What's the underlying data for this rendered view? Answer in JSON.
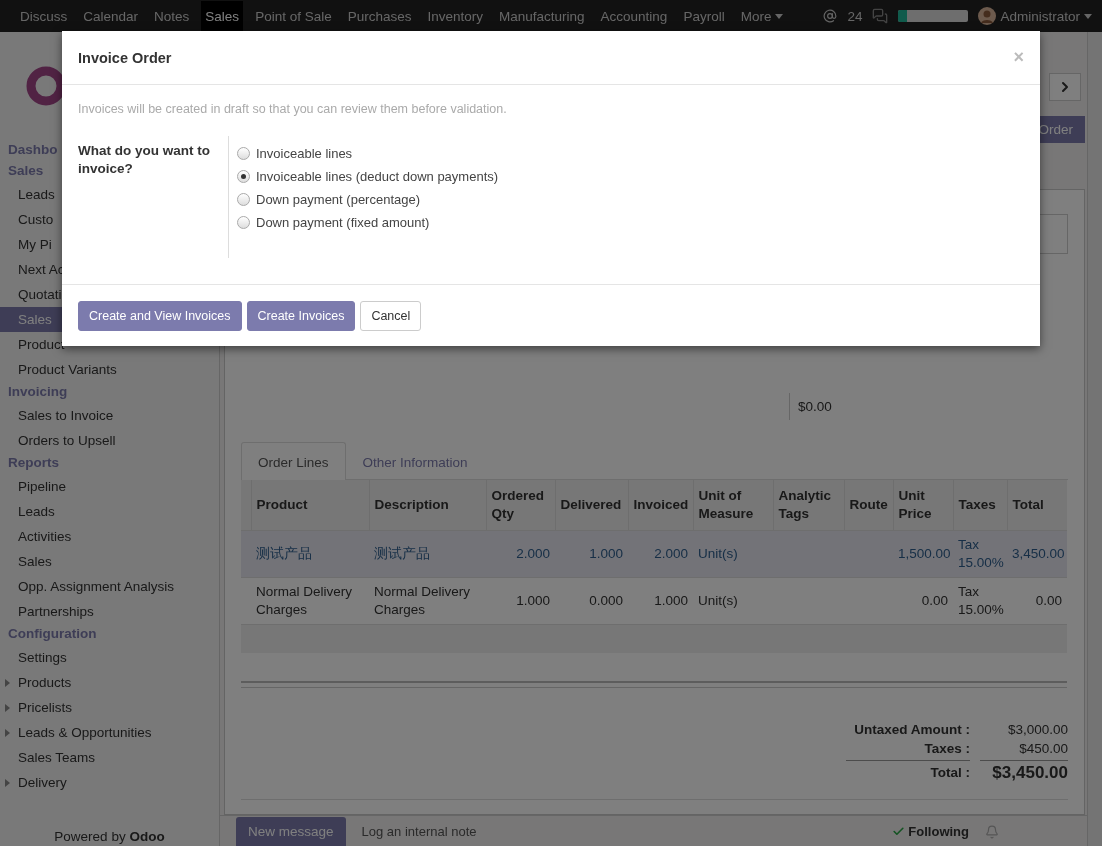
{
  "nav": {
    "items": [
      {
        "label": "Discuss",
        "selected": false
      },
      {
        "label": "Calendar",
        "selected": false
      },
      {
        "label": "Notes",
        "selected": false
      },
      {
        "label": "Sales",
        "selected": true
      },
      {
        "label": "Point of Sale",
        "selected": false
      },
      {
        "label": "Purchases",
        "selected": false
      },
      {
        "label": "Inventory",
        "selected": false
      },
      {
        "label": "Manufacturing",
        "selected": false
      },
      {
        "label": "Accounting",
        "selected": false
      },
      {
        "label": "Payroll",
        "selected": false
      },
      {
        "label": "More",
        "selected": false
      }
    ],
    "mentions": "24",
    "progress": {
      "level": 0.12
    },
    "user": "Administrator"
  },
  "sidebar": {
    "sections": [
      {
        "title": "Dashbo"
      },
      {
        "title": "Sales",
        "items": [
          {
            "label": "Leads",
            "selected": false
          },
          {
            "label": "Custo",
            "selected": false
          },
          {
            "label": "My Pi",
            "selected": false
          },
          {
            "label": "Next Ac",
            "selected": false
          },
          {
            "label": "Quotati",
            "selected": false
          },
          {
            "label": "Sales",
            "selected": true
          },
          {
            "label": "Product",
            "selected": false
          },
          {
            "label": "Product Variants",
            "selected": false
          }
        ]
      },
      {
        "title": "Invoicing",
        "items": [
          {
            "label": "Sales to Invoice",
            "selected": false
          },
          {
            "label": "Orders to Upsell",
            "selected": false
          }
        ]
      },
      {
        "title": "Reports",
        "items": [
          {
            "label": "Pipeline",
            "selected": false
          },
          {
            "label": "Leads",
            "selected": false
          },
          {
            "label": "Activities",
            "selected": false
          },
          {
            "label": "Sales",
            "selected": false
          },
          {
            "label": "Opp. Assignment Analysis",
            "selected": false
          },
          {
            "label": "Partnerships",
            "selected": false
          }
        ]
      },
      {
        "title": "Configuration",
        "items": [
          {
            "label": "Settings",
            "selected": false
          },
          {
            "label": "Products",
            "selected": false,
            "expanded": false
          },
          {
            "label": "Pricelists",
            "selected": false,
            "expanded": false
          },
          {
            "label": "Leads & Opportunities",
            "selected": false,
            "expanded": false
          },
          {
            "label": "Sales Teams",
            "selected": false
          },
          {
            "label": "Delivery",
            "selected": false,
            "expanded": false
          }
        ]
      }
    ],
    "footer": "Powered by **Odoo**"
  },
  "control_panel": {
    "action_button": "Order"
  },
  "form": {
    "amount": "$0.00",
    "tabs": [
      {
        "label": "Order Lines",
        "selected": true
      },
      {
        "label": "Other Information",
        "selected": false
      }
    ],
    "table": {
      "columns": [
        {
          "label": "Product"
        },
        {
          "label": "Description"
        },
        {
          "label": "Ordered Qty"
        },
        {
          "label": "Delivered"
        },
        {
          "label": "Invoiced"
        },
        {
          "label": "Unit of Measure"
        },
        {
          "label": "Analytic Tags"
        },
        {
          "label": "Route"
        },
        {
          "label": "Unit Price"
        },
        {
          "label": "Taxes"
        },
        {
          "label": "Total"
        }
      ],
      "rows": [
        {
          "selected": true,
          "cells": [
            "测试产品",
            "测试产品",
            "2.000",
            "1.000",
            "2.000",
            "Unit(s)",
            "",
            "",
            "1,500.00",
            "Tax 15.00%",
            "3,450.00"
          ]
        },
        {
          "selected": false,
          "cells": [
            "Normal Delivery Charges",
            "Normal Delivery Charges",
            "1.000",
            "0.000",
            "1.000",
            "Unit(s)",
            "",
            "",
            "0.00",
            "Tax 15.00%",
            "0.00"
          ]
        }
      ]
    },
    "totals": [
      {
        "label": "Untaxed Amount :",
        "value": "$3,000.00",
        "kind": "normal"
      },
      {
        "label": "Taxes :",
        "value": "$450.00",
        "kind": "normal"
      },
      {
        "label": "Total :",
        "value": "$3,450.00",
        "kind": "grand"
      }
    ]
  },
  "chatter": {
    "new_message": "New message",
    "log_note": "Log an internal note",
    "following": "Following"
  },
  "modal": {
    "title": "Invoice Order",
    "close": "×",
    "notice": "Invoices will be created in draft so that you can review them before validation.",
    "question": "What do you want to invoice?",
    "options": [
      {
        "label": "Invoiceable lines",
        "selected": false
      },
      {
        "label": "Invoiceable lines (deduct down payments)",
        "selected": true
      },
      {
        "label": "Down payment (percentage)",
        "selected": false
      },
      {
        "label": "Down payment (fixed amount)",
        "selected": false
      }
    ],
    "buttons": [
      {
        "label": "Create and View Invoices",
        "kind": "primary"
      },
      {
        "label": "Create Invoices",
        "kind": "primary"
      },
      {
        "label": "Cancel",
        "kind": "default"
      }
    ]
  }
}
